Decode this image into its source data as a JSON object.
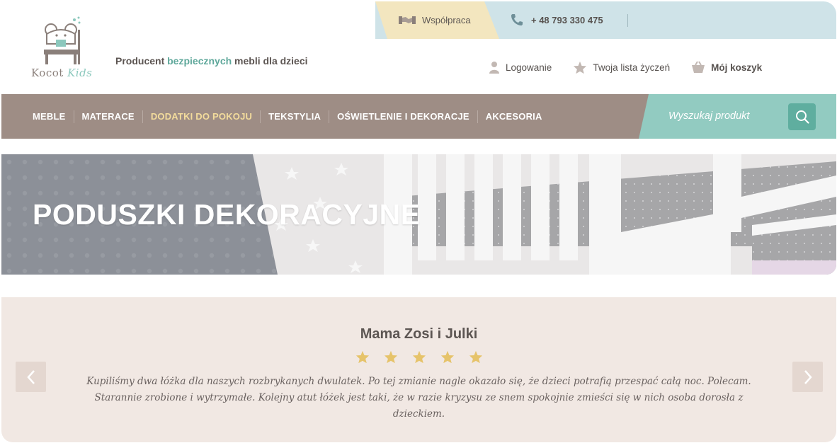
{
  "topbar": {
    "cooperation_label": "Współpraca",
    "phone": "+ 48 793 330 475"
  },
  "logo": {
    "brand_main": "Kocot",
    "brand_accent": "Kids"
  },
  "tagline": {
    "prefix": "Producent ",
    "accent": "bezpiecznych",
    "suffix": " mebli dla dzieci"
  },
  "user_links": {
    "login": "Logowanie",
    "wishlist": "Twoja lista życzeń",
    "cart": "Mój koszyk"
  },
  "nav": {
    "items": [
      {
        "label": "MEBLE",
        "active": false
      },
      {
        "label": "MATERACE",
        "active": false
      },
      {
        "label": "DODATKI DO POKOJU",
        "active": true
      },
      {
        "label": "TEKSTYLIA",
        "active": false
      },
      {
        "label": "OŚWIETLENIE I DEKORACJE",
        "active": false
      },
      {
        "label": "AKCESORIA",
        "active": false
      }
    ],
    "search_placeholder": "Wyszukaj produkt"
  },
  "hero": {
    "title": "PODUSZKI DEKORACYJNE"
  },
  "review": {
    "author": "Mama Zosi i Julki",
    "rating": 5,
    "text": "Kupiliśmy dwa łóżka dla naszych rozbrykanych dwulatek. Po tej zmianie nagle okazało się, że dzieci potrafią przespać całą noc. Polecam. Starannie zrobione i wytrzymałe. Kolejny atut łóżek jest taki, że w razie kryzysu ze snem spokojnie zmieści się w nich osoba dorosła z dzieckiem."
  },
  "colors": {
    "nav_bg": "#9e8d85",
    "nav_active": "#f3dc9c",
    "search_bg": "#92cbc1",
    "search_button": "#5fae9f",
    "accent_green": "#5fa89b",
    "review_bg": "#f1e8e3",
    "star": "#e6c36a"
  },
  "icons": {
    "cooperation": "handshake-icon",
    "phone": "phone-icon",
    "login": "user-icon",
    "wishlist": "star-icon",
    "cart": "basket-icon",
    "search": "search-icon",
    "prev": "chevron-left-icon",
    "next": "chevron-right-icon"
  }
}
